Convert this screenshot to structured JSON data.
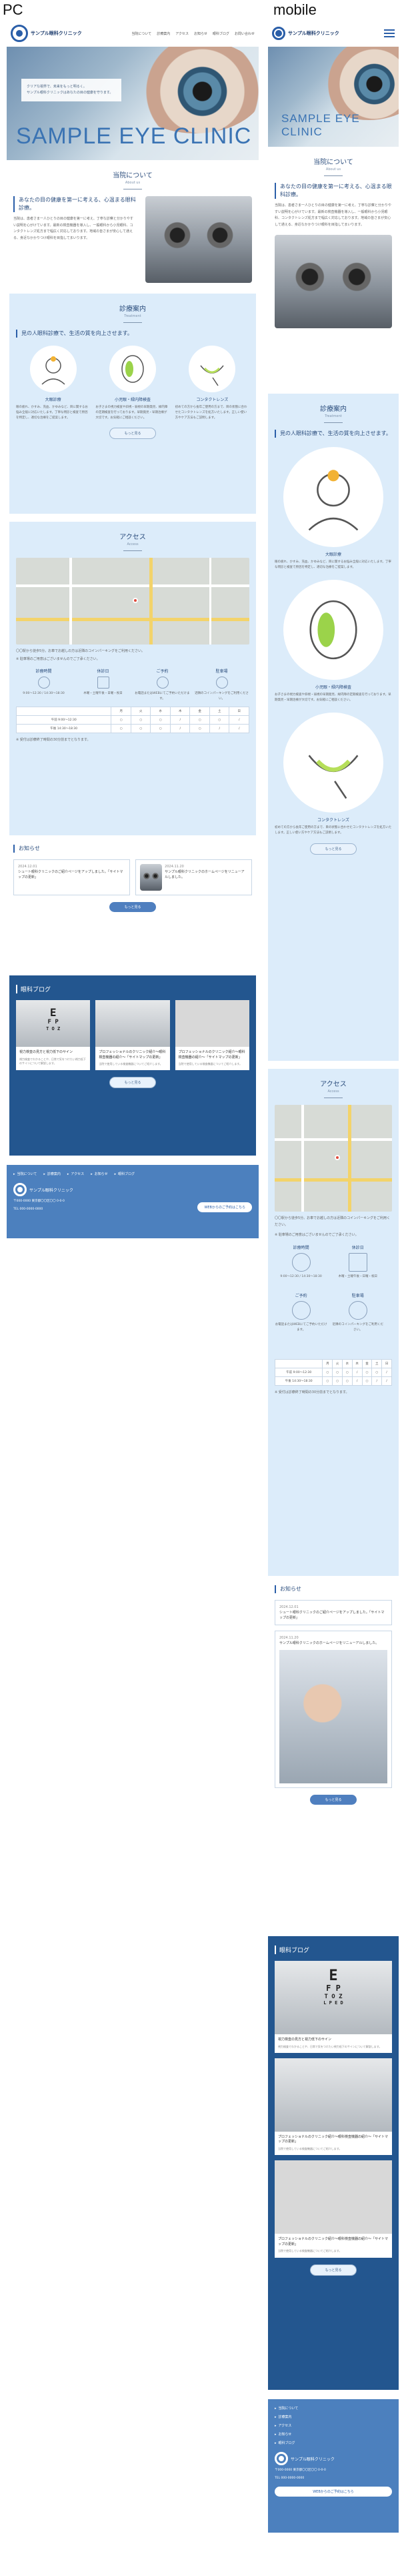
{
  "labels": {
    "pc": "PC",
    "mobile": "mobile"
  },
  "brand": {
    "name": "サンプル眼科クリニック"
  },
  "nav": [
    "当院について",
    "診療案内",
    "アクセス",
    "お知らせ",
    "眼科ブログ",
    "お問い合わせ"
  ],
  "hero": {
    "title": "SAMPLE EYE CLINIC",
    "copy_1": "クリアな視界で、未来をもっと明るく。",
    "copy_2": "サンプル眼科クリニックはあなたの目の健康を守ります。"
  },
  "about": {
    "title": "当院について",
    "sub": "About us",
    "lead": "あなたの目の健康を第一に考える、心温まる眼科診療。",
    "body": "当院は、患者さま一人ひとりの目の健康を第一に考え、丁寧な診察と分かりやすい説明を心がけています。最新の検査機器を導入し、一般眼科から小児眼科、コンタクトレンズ処方まで幅広く対応しております。地域の皆さまが安心して通える、身近なかかりつけ眼科を目指してまいります。"
  },
  "services": {
    "title": "診療案内",
    "sub": "Treatment",
    "lead": "見の人眼科診療で、生活の質を向上させます。",
    "items": [
      {
        "title": "大眼診療",
        "body": "眼の疲れ、かすみ、充血、かゆみなど、目に関するお悩み全般に対応いたします。丁寧な問診と検査で原因を特定し、適切な治療をご提案します。"
      },
      {
        "title": "小児眼・緑内障検査",
        "body": "お子さまの視力検査や斜視・弱視の早期発見、緑内障の定期検査を行っております。早期発見・早期治療が大切です。お気軽にご相談ください。"
      },
      {
        "title": "コンタクトレンズ",
        "body": "初めての方から長年ご使用の方まで、目の状態に合わせたコンタクトレンズを処方いたします。正しい使い方やケア方法もご説明します。"
      }
    ],
    "button": "もっと見る"
  },
  "access": {
    "title": "アクセス",
    "sub": "Access",
    "note_1": "〇〇駅から徒歩5分。お車でお越しの方は近隣のコインパーキングをご利用ください。",
    "note_2": "※ 駐車場のご用意はございませんのでご了承ください。",
    "info": [
      {
        "title": "診療時間",
        "body": "9:00〜12:30 / 14:30〜18:30"
      },
      {
        "title": "休診日",
        "body": "木曜・土曜午後・日曜・祝日"
      },
      {
        "title": "ご予約",
        "body": "お電話またはWEBにてご予約いただけます。"
      },
      {
        "title": "駐車場",
        "body": "近隣のコインパーキングをご利用ください。"
      }
    ],
    "hours_header": [
      "",
      "月",
      "火",
      "水",
      "木",
      "金",
      "土",
      "日"
    ],
    "hours_rows": [
      [
        "午前 9:00〜12:30",
        "○",
        "○",
        "○",
        "/",
        "○",
        "○",
        "/"
      ],
      [
        "午後 14:30〜18:30",
        "○",
        "○",
        "○",
        "/",
        "○",
        "/",
        "/"
      ]
    ],
    "hours_note": "※ 受付は診療終了時間の30分前までとなります。"
  },
  "news": {
    "title": "お知らせ",
    "items": [
      {
        "date": "2024.12.01",
        "text": "シュート眼科クリニックのご紹介ページをアップしました。「サイトマップの更新」"
      },
      {
        "date": "2024.11.20",
        "text": "サンプル眼科クリニックのホームページをリニューアルしました。"
      }
    ],
    "button": "もっと見る"
  },
  "blog": {
    "title": "眼科ブログ",
    "items": [
      {
        "title": "視力検査の見方と視力低下のサイン",
        "body": "視力検査でわかることや、日常で気をつけたい視力低下のサインについて解説します。"
      },
      {
        "title": "プロフェッショナルのクリニック紹介～眼科検査機器の紹介～「サイトマップの更新」",
        "body": "当院で使用している検査機器についてご紹介します。"
      },
      {
        "title": "プロフェッショナルのクリニック紹介～眼科検査機器の紹介～「サイトマップの更新」",
        "body": "当院で使用している検査機器についてご紹介します。"
      }
    ],
    "button": "もっと見る",
    "chart_letters": [
      "E",
      "F P",
      "T O Z",
      "L P E D"
    ]
  },
  "footer": {
    "links": [
      "当院について",
      "診療案内",
      "アクセス",
      "お知らせ",
      "眼科ブログ"
    ],
    "address": "〒000-0000 東京都〇〇区〇〇 0-0-0",
    "tel": "TEL 000-0000-0000",
    "cta": "WEBからのご予約はこちら",
    "copyright": "© SAMPLE EYE CLINIC"
  }
}
